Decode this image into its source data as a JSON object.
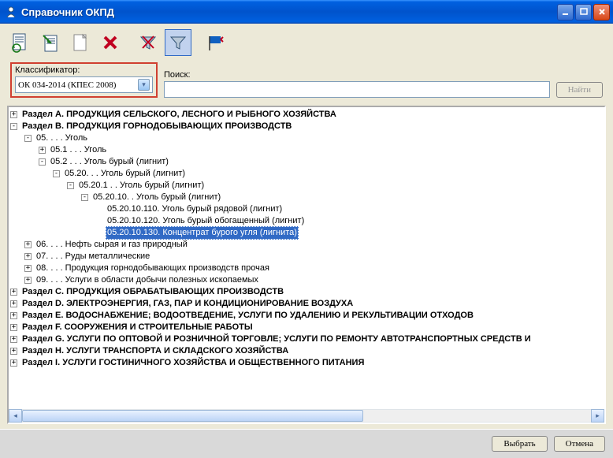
{
  "window": {
    "title": "Справочник ОКПД",
    "minimize": "_",
    "maximize": "□",
    "close": "×"
  },
  "filter": {
    "classifier_label": "Классификатор:",
    "classifier_value": "ОК 034-2014 (КПЕС 2008)",
    "search_label": "Поиск:",
    "search_value": "",
    "find_button": "Найти"
  },
  "tree": [
    {
      "lvl": 0,
      "exp": "+",
      "bold": true,
      "text": "Раздел A. ПРОДУКЦИЯ СЕЛЬСКОГО, ЛЕСНОГО И РЫБНОГО ХОЗЯЙСТВА"
    },
    {
      "lvl": 0,
      "exp": "-",
      "bold": true,
      "text": "Раздел B. ПРОДУКЦИЯ ГОРНОДОБЫВАЮЩИХ ПРОИЗВОДСТВ"
    },
    {
      "lvl": 1,
      "exp": "-",
      "bold": false,
      "text": "05. .  .  . Уголь"
    },
    {
      "lvl": 2,
      "exp": "+",
      "bold": false,
      "text": "05.1 .  .  . Уголь"
    },
    {
      "lvl": 2,
      "exp": "-",
      "bold": false,
      "text": "05.2 .  .  . Уголь бурый (лигнит)"
    },
    {
      "lvl": 3,
      "exp": "-",
      "bold": false,
      "text": "05.20.  .  . Уголь бурый (лигнит)"
    },
    {
      "lvl": 4,
      "exp": "-",
      "bold": false,
      "text": "05.20.1 .  . Уголь бурый (лигнит)"
    },
    {
      "lvl": 5,
      "exp": "-",
      "bold": false,
      "text": "05.20.10.  . Уголь бурый (лигнит)"
    },
    {
      "lvl": 6,
      "exp": " ",
      "bold": false,
      "text": "05.20.10.110. Уголь бурый рядовой (лигнит)"
    },
    {
      "lvl": 6,
      "exp": " ",
      "bold": false,
      "text": "05.20.10.120. Уголь бурый обогащенный (лигнит)"
    },
    {
      "lvl": 6,
      "exp": " ",
      "bold": false,
      "selected": true,
      "text": "05.20.10.130. Концентрат бурого угля (лигнита)"
    },
    {
      "lvl": 1,
      "exp": "+",
      "bold": false,
      "text": "06. .  .  . Нефть сырая и газ природный"
    },
    {
      "lvl": 1,
      "exp": "+",
      "bold": false,
      "text": "07. .  .  . Руды металлические"
    },
    {
      "lvl": 1,
      "exp": "+",
      "bold": false,
      "text": "08. .  .  . Продукция горнодобывающих производств прочая"
    },
    {
      "lvl": 1,
      "exp": "+",
      "bold": false,
      "text": "09. .  .  . Услуги в области добычи полезных ископаемых"
    },
    {
      "lvl": 0,
      "exp": "+",
      "bold": true,
      "text": "Раздел C. ПРОДУКЦИЯ ОБРАБАТЫВАЮЩИХ ПРОИЗВОДСТВ"
    },
    {
      "lvl": 0,
      "exp": "+",
      "bold": true,
      "text": "Раздел D. ЭЛЕКТРОЭНЕРГИЯ, ГАЗ, ПАР И КОНДИЦИОНИРОВАНИЕ ВОЗДУХА"
    },
    {
      "lvl": 0,
      "exp": "+",
      "bold": true,
      "text": "Раздел E. ВОДОСНАБЖЕНИЕ; ВОДООТВЕДЕНИЕ, УСЛУГИ ПО УДАЛЕНИЮ И РЕКУЛЬТИВАЦИИ ОТХОДОВ"
    },
    {
      "lvl": 0,
      "exp": "+",
      "bold": true,
      "text": "Раздел F. СООРУЖЕНИЯ И СТРОИТЕЛЬНЫЕ РАБОТЫ"
    },
    {
      "lvl": 0,
      "exp": "+",
      "bold": true,
      "text": "Раздел G. УСЛУГИ ПО ОПТОВОЙ И РОЗНИЧНОЙ ТОРГОВЛЕ; УСЛУГИ ПО РЕМОНТУ АВТОТРАНСПОРТНЫХ СРЕДСТВ И"
    },
    {
      "lvl": 0,
      "exp": "+",
      "bold": true,
      "text": "Раздел H. УСЛУГИ ТРАНСПОРТА И СКЛАДСКОГО ХОЗЯЙСТВА"
    },
    {
      "lvl": 0,
      "exp": "+",
      "bold": true,
      "text": "Раздел I. УСЛУГИ ГОСТИНИЧНОГО ХОЗЯЙСТВА И ОБЩЕСТВЕННОГО ПИТАНИЯ"
    }
  ],
  "buttons": {
    "select": "Выбрать",
    "cancel": "Отмена"
  }
}
